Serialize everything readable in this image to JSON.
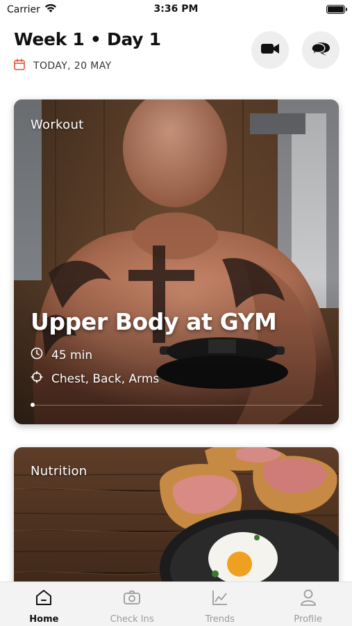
{
  "status_bar": {
    "carrier": "Carrier",
    "time": "3:36 PM",
    "icons": [
      "wifi-icon",
      "battery-icon"
    ]
  },
  "header": {
    "title": "Week 1 • Day 1",
    "date": "TODAY, 20 MAY",
    "actions": [
      "video-camera-icon",
      "chat-bubbles-icon"
    ]
  },
  "workout_card": {
    "label": "Workout",
    "title": "Upper Body at GYM",
    "duration": "45 min",
    "focus": "Chest, Back, Arms",
    "carousel_index": 1
  },
  "nutrition_card": {
    "label": "Nutrition"
  },
  "tab_bar": {
    "tabs": [
      {
        "label": "Home",
        "icon": "home-icon",
        "active": true
      },
      {
        "label": "Check Ins",
        "icon": "camera-icon",
        "active": false
      },
      {
        "label": "Trends",
        "icon": "chart-icon",
        "active": false
      },
      {
        "label": "Profile",
        "icon": "user-icon",
        "active": false
      }
    ]
  },
  "colors": {
    "accent": "#e5533d",
    "tab_active": "#111111",
    "tab_inactive": "#9a9a9a",
    "button_bg": "#eeeeee"
  }
}
